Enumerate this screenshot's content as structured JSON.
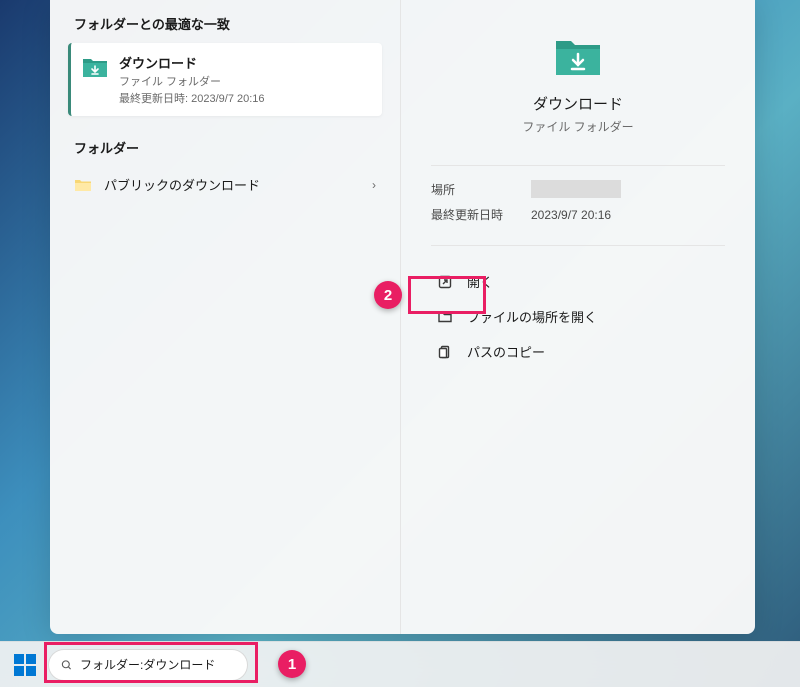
{
  "left": {
    "best_match_header": "フォルダーとの最適な一致",
    "best_match": {
      "title": "ダウンロード",
      "subtitle": "ファイル フォルダー",
      "meta": "最終更新日時: 2023/9/7 20:16"
    },
    "folder_header": "フォルダー",
    "other_folder": "パブリックのダウンロード"
  },
  "preview": {
    "title": "ダウンロード",
    "subtitle": "ファイル フォルダー",
    "location_label": "場所",
    "modified_label": "最終更新日時",
    "modified_value": "2023/9/7 20:16",
    "actions": {
      "open": "開く",
      "open_location": "ファイルの場所を開く",
      "copy_path": "パスのコピー"
    }
  },
  "search": {
    "value": "フォルダー:ダウンロード"
  },
  "annotations": {
    "one": "1",
    "two": "2"
  }
}
